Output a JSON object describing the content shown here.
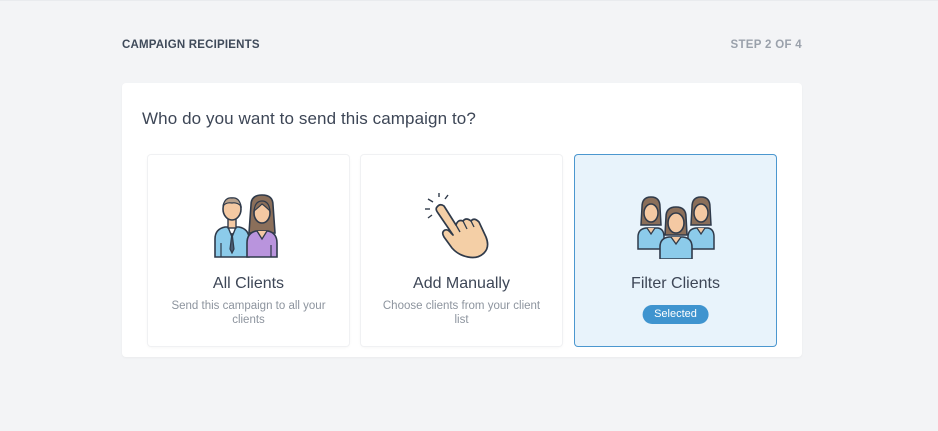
{
  "header": {
    "title": "CAMPAIGN RECIPIENTS",
    "step": "STEP 2 OF 4"
  },
  "panel": {
    "question": "Who do you want to send this campaign to?",
    "options": [
      {
        "title": "All Clients",
        "description": "Send this campaign to all your clients",
        "icon": "couple-icon",
        "selected": false
      },
      {
        "title": "Add Manually",
        "description": "Choose clients from your client list",
        "icon": "pointing-hand-icon",
        "selected": false
      },
      {
        "title": "Filter Clients",
        "badge": "Selected",
        "icon": "group-icon",
        "selected": true
      }
    ]
  },
  "colors": {
    "selected_border": "#4b97cf",
    "selected_background": "#e8f3fb",
    "badge_background": "#3f94cf",
    "page_background": "#f3f4f6"
  }
}
